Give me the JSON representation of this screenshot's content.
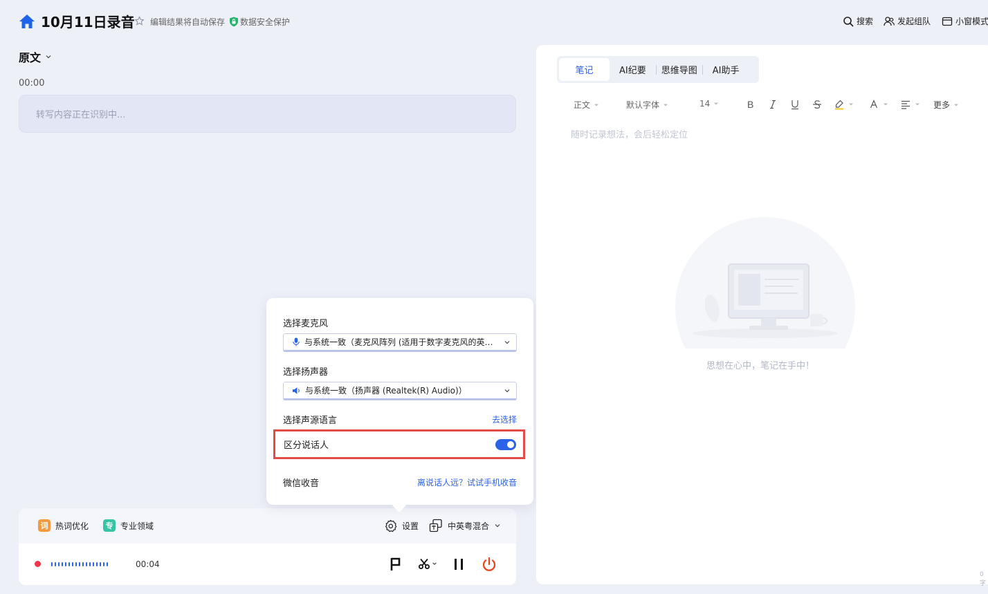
{
  "header": {
    "title": "10月11日录音",
    "autosave_text": "编辑结果将自动保存",
    "security_text": "数据安全保护",
    "actions": {
      "search": "搜索",
      "team": "发起组队",
      "mini_window": "小窗模式"
    }
  },
  "left": {
    "section_label": "原文",
    "timestamp": "00:00",
    "transcribe_status": "转写内容正在识别中..."
  },
  "popover": {
    "mic_label": "选择麦克风",
    "mic_value": "与系统一致（麦克风阵列 (适用于数字麦克风的英特尔®...",
    "speaker_label": "选择扬声器",
    "speaker_value": "与系统一致（扬声器 (Realtek(R) Audio)）",
    "lang_label": "选择声源语言",
    "lang_link": "去选择",
    "diarize_label": "区分说话人",
    "diarize_on": true,
    "wechat_label": "微信收音",
    "wechat_link": "离说话人远？试试手机收音"
  },
  "bottom": {
    "hotword_icon": "词",
    "hotword_label": "热词优化",
    "domain_icon": "专",
    "domain_label": "专业领域",
    "settings_label": "设置",
    "language_label": "中英粤混合",
    "rec_time": "00:04"
  },
  "right": {
    "tabs": [
      "笔记",
      "AI纪要",
      "思维导图",
      "AI助手"
    ],
    "format": {
      "paragraph": "正文",
      "font": "默认字体",
      "size": "14",
      "more": "更多"
    },
    "note_placeholder": "随时记录想法，会后轻松定位",
    "empty_text": "思想在心中，笔记在手中！",
    "wordcount": "0字"
  },
  "colors": {
    "accent": "#2a62e8",
    "record_red": "#f0364a",
    "highlight_border": "#e34a4a",
    "hotword_orange": "#f59a3c",
    "domain_green": "#36c3a6"
  }
}
